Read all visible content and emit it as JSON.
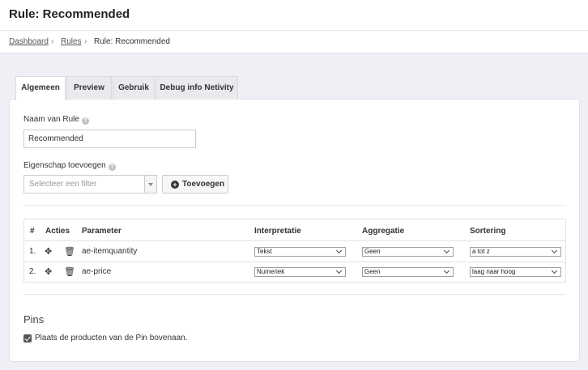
{
  "header": {
    "title": "Rule: Recommended"
  },
  "breadcrumb": {
    "dashboard": "Dashboard",
    "rules": "Rules",
    "current": "Rule: Recommended",
    "separator": "›"
  },
  "tabs": [
    "Algemeen",
    "Preview",
    "Gebruik",
    "Debug info Netivity"
  ],
  "form": {
    "name_label": "Naam van Rule",
    "name_value": "Recommended",
    "property_label": "Eigenschap toevoegen",
    "filter_placeholder": "Selecteer een filter",
    "add_button": "Toevoegen",
    "help_glyph": "?"
  },
  "table": {
    "headers": [
      "#",
      "Acties",
      "Parameter",
      "Interpretatie",
      "Aggregatie",
      "Sortering"
    ],
    "rows": [
      {
        "num": "1.",
        "parameter": "ae-itemquantity",
        "interpretatie": "Tekst",
        "aggregatie": "Geen",
        "sortering": "a tot z"
      },
      {
        "num": "2.",
        "parameter": "ae-price",
        "interpretatie": "Numeriek",
        "aggregatie": "Geen",
        "sortering": "laag naar hoog"
      }
    ]
  },
  "pins": {
    "title": "Pins",
    "checkbox_label": "Plaats de producten van de Pin bovenaan.",
    "checked": true
  },
  "icons": {
    "move": "move-arrows-icon",
    "delete": "trash-icon",
    "add": "plus-circle-icon",
    "help": "help-circle-icon"
  }
}
